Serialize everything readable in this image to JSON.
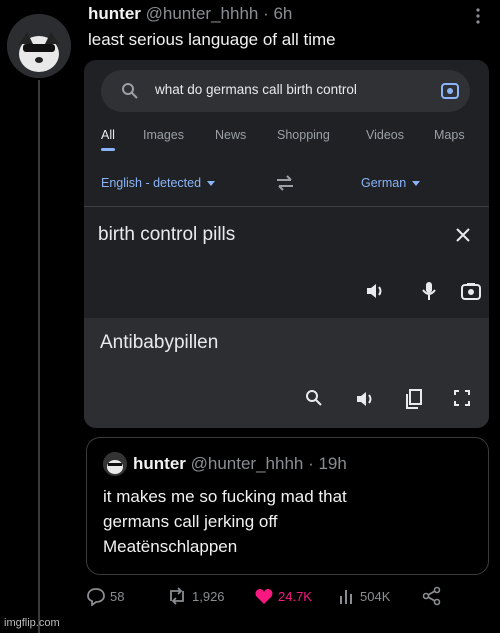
{
  "post": {
    "author_name": "hunter",
    "author_handle": "@hunter_hhhh · 6h",
    "text": "least serious language of all time"
  },
  "translate": {
    "search_query": "what do germans call birth control",
    "tabs": [
      "All",
      "Images",
      "News",
      "Shopping",
      "Videos",
      "Maps"
    ],
    "source_lang": "English - detected",
    "target_lang": "German",
    "source_text": "birth control pills",
    "translation": "Antibabypillen",
    "accent_color": "#8ab4f8"
  },
  "quoted": {
    "author_name": "hunter",
    "author_handle": "@hunter_hhhh · 19h",
    "lines": [
      "it makes me so fucking mad that",
      "germans call jerking off",
      "Meatënschlappen"
    ]
  },
  "actions": {
    "replies": "58",
    "reposts": "1,926",
    "likes": "24.7K",
    "views": "504K",
    "like_color": "#f91880"
  },
  "watermark": "imgflip.com"
}
